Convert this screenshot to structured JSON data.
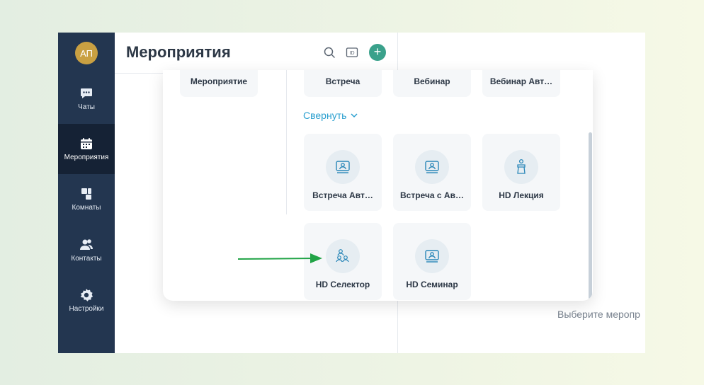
{
  "sidebar": {
    "avatar": "АП",
    "items": [
      {
        "label": "Чаты",
        "icon": "chat-icon"
      },
      {
        "label": "Мероприятия",
        "icon": "calendar-icon",
        "active": true
      },
      {
        "label": "Комнаты",
        "icon": "rooms-icon"
      },
      {
        "label": "Контакты",
        "icon": "contacts-icon"
      },
      {
        "label": "Настройки",
        "icon": "gear-icon"
      }
    ]
  },
  "header": {
    "title": "Мероприятия",
    "icons": [
      "search-icon",
      "id-icon",
      "plus-icon"
    ],
    "add_label": "+"
  },
  "right_panel": {
    "hint": "Выберите меропр"
  },
  "popup": {
    "left_tile": "Мероприятие",
    "top_tiles": [
      "Встреча",
      "Вебинар",
      "Вебинар Авт…"
    ],
    "collapse_label": "Свернуть",
    "tiles": [
      {
        "label": "Встреча Авт…",
        "icon": "presentation-icon"
      },
      {
        "label": "Встреча с Ав…",
        "icon": "presentation-icon"
      },
      {
        "label": "HD Лекция",
        "icon": "lecture-icon"
      },
      {
        "label": "HD Селектор",
        "icon": "group-icon"
      },
      {
        "label": "HD Семинар",
        "icon": "presentation-icon"
      }
    ]
  },
  "colors": {
    "sidebar": "#233650",
    "sidebar_active": "#152235",
    "accent": "#3aa18b",
    "link": "#2a9fcf",
    "avatar": "#c9a042",
    "arrow": "#22a447"
  }
}
